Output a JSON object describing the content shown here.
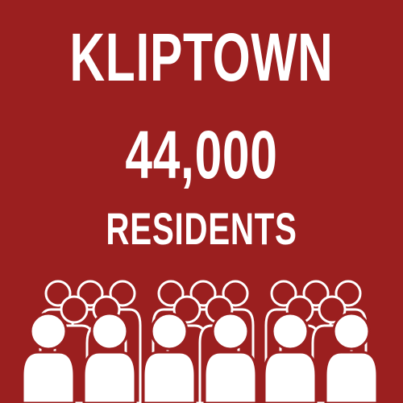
{
  "title": "KLIPTOWN",
  "count": "44,000",
  "label": "RESIDENTS",
  "icon": "crowd-icon",
  "colors": {
    "background": "#9b1f1f",
    "foreground": "#ffffff"
  }
}
